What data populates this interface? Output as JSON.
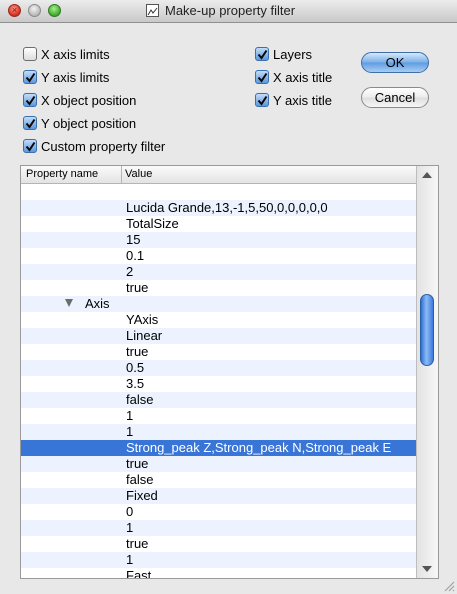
{
  "window": {
    "title": "Make-up property filter"
  },
  "checks": [
    {
      "label": "X axis limits",
      "checked": false
    },
    {
      "label": "Y axis limits",
      "checked": true
    },
    {
      "label": "X object position",
      "checked": true
    },
    {
      "label": "Y object position",
      "checked": true
    },
    {
      "label": "Custom property filter",
      "checked": true
    },
    {
      "label": "Layers",
      "checked": true
    },
    {
      "label": "X axis title",
      "checked": true
    },
    {
      "label": "Y axis title",
      "checked": true
    }
  ],
  "buttons": {
    "ok": "OK",
    "cancel": "Cancel"
  },
  "table": {
    "columns": [
      "Property name",
      "Value"
    ],
    "rows": [
      {
        "name": "",
        "value": ""
      },
      {
        "name": "",
        "value": "Lucida Grande,13,-1,5,50,0,0,0,0,0"
      },
      {
        "name": "",
        "value": "TotalSize"
      },
      {
        "name": "",
        "value": "15"
      },
      {
        "name": "",
        "value": "0.1"
      },
      {
        "name": "",
        "value": "2"
      },
      {
        "name": "",
        "value": "true"
      },
      {
        "name": "Axis",
        "value": "",
        "expanded": true
      },
      {
        "name": "",
        "value": "YAxis"
      },
      {
        "name": "",
        "value": "Linear"
      },
      {
        "name": "",
        "value": "true"
      },
      {
        "name": "",
        "value": "0.5"
      },
      {
        "name": "",
        "value": "3.5"
      },
      {
        "name": "",
        "value": "false"
      },
      {
        "name": "",
        "value": "1"
      },
      {
        "name": "",
        "value": "1"
      },
      {
        "name": "",
        "value": "Strong_peak Z,Strong_peak N,Strong_peak E",
        "selected": true
      },
      {
        "name": "",
        "value": "true"
      },
      {
        "name": "",
        "value": "false"
      },
      {
        "name": "",
        "value": "Fixed"
      },
      {
        "name": "",
        "value": "0"
      },
      {
        "name": "",
        "value": "1"
      },
      {
        "name": "",
        "value": "true"
      },
      {
        "name": "",
        "value": "1"
      },
      {
        "name": "",
        "value": "Fast"
      }
    ]
  },
  "scrollbar": {
    "position": 0.42
  }
}
